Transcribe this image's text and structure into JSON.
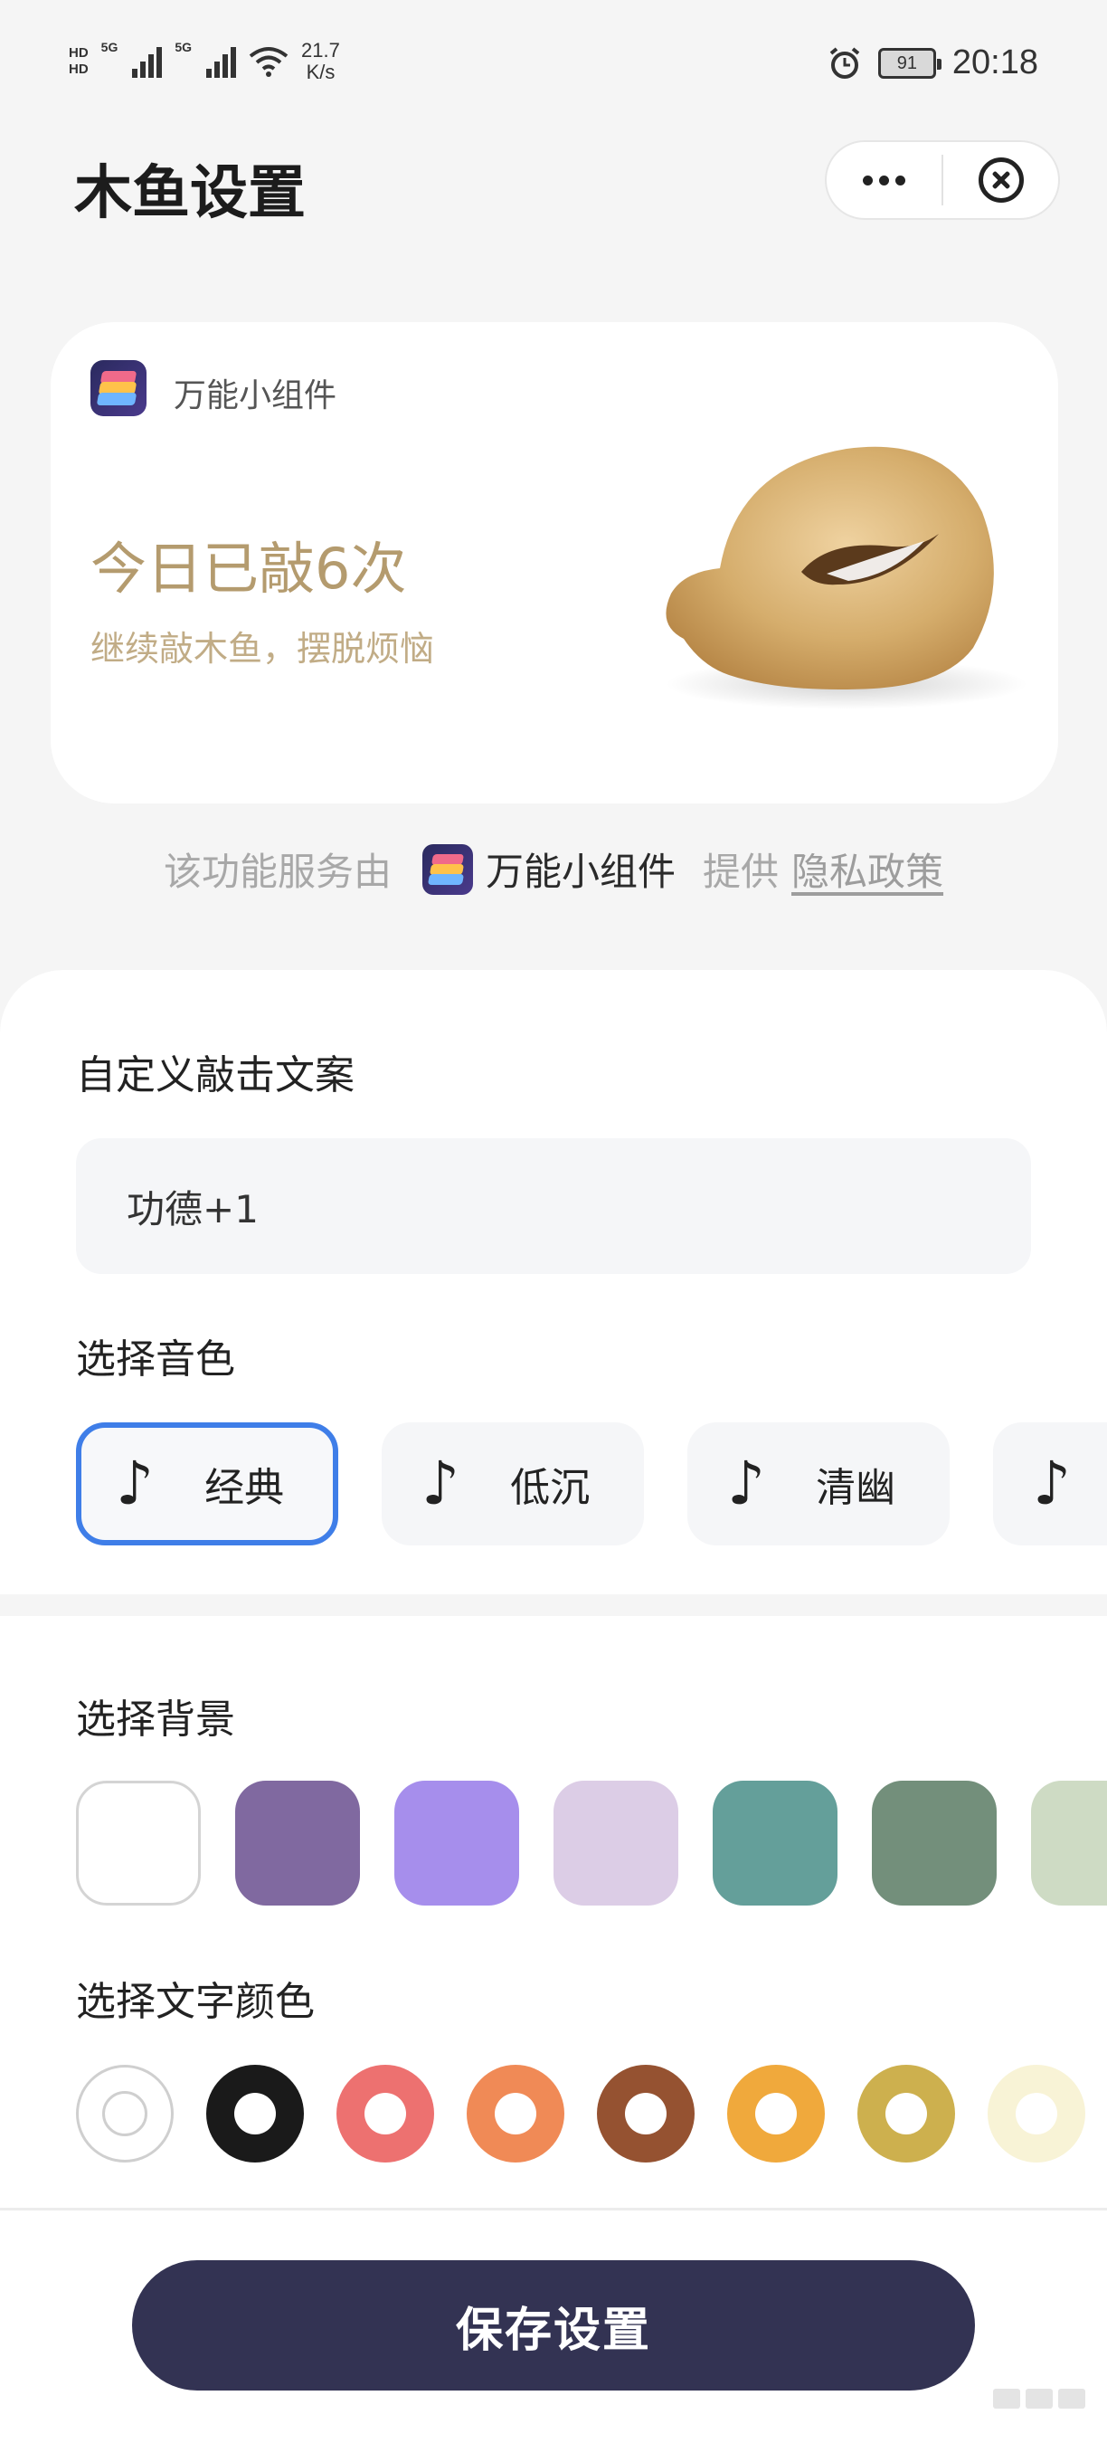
{
  "status_bar": {
    "hd_1": "HD",
    "hd_2": "HD",
    "net_1": "5G",
    "net_2": "5G",
    "speed_value": "21.7",
    "speed_unit": "K/s",
    "battery": "91",
    "time": "20:18",
    "icons": [
      "signal-icon",
      "wifi-icon",
      "alarm-icon",
      "battery-icon"
    ]
  },
  "header": {
    "title": "木鱼设置",
    "more_icon": "more-dots-icon",
    "close_icon": "close-circle-icon"
  },
  "preview": {
    "app_name": "万能小组件",
    "count_text": "今日已敲6次",
    "sub_text": "继续敲木鱼，摆脱烦恼",
    "accent_color": "#b49b6e"
  },
  "provider": {
    "prefix": "该功能服务由",
    "name": "万能小组件",
    "suffix": "提供",
    "privacy_link": "隐私政策"
  },
  "settings": {
    "custom_text_label": "自定义敲击文案",
    "custom_text_value": "功德+1",
    "sound_label": "选择音色",
    "sounds": [
      {
        "label": "经典",
        "selected": true
      },
      {
        "label": "低沉",
        "selected": false
      },
      {
        "label": "清幽",
        "selected": false
      },
      {
        "label": "",
        "selected": false
      }
    ],
    "background_label": "选择背景",
    "backgrounds": [
      "#ffffff",
      "#8069a0",
      "#a68eec",
      "#dccde6",
      "#649f9a",
      "#738f7b",
      "#cedbc4"
    ],
    "text_color_label": "选择文字颜色",
    "text_colors": [
      "#ffffff",
      "#1a1a1a",
      "#ed7170",
      "#f08a56",
      "#955231",
      "#f0a93c",
      "#cdb04e",
      "#f8f3d6"
    ],
    "selected_sound_border": "#3f7ee8"
  },
  "footer": {
    "save_label": "保存设置",
    "button_color": "#333353"
  }
}
